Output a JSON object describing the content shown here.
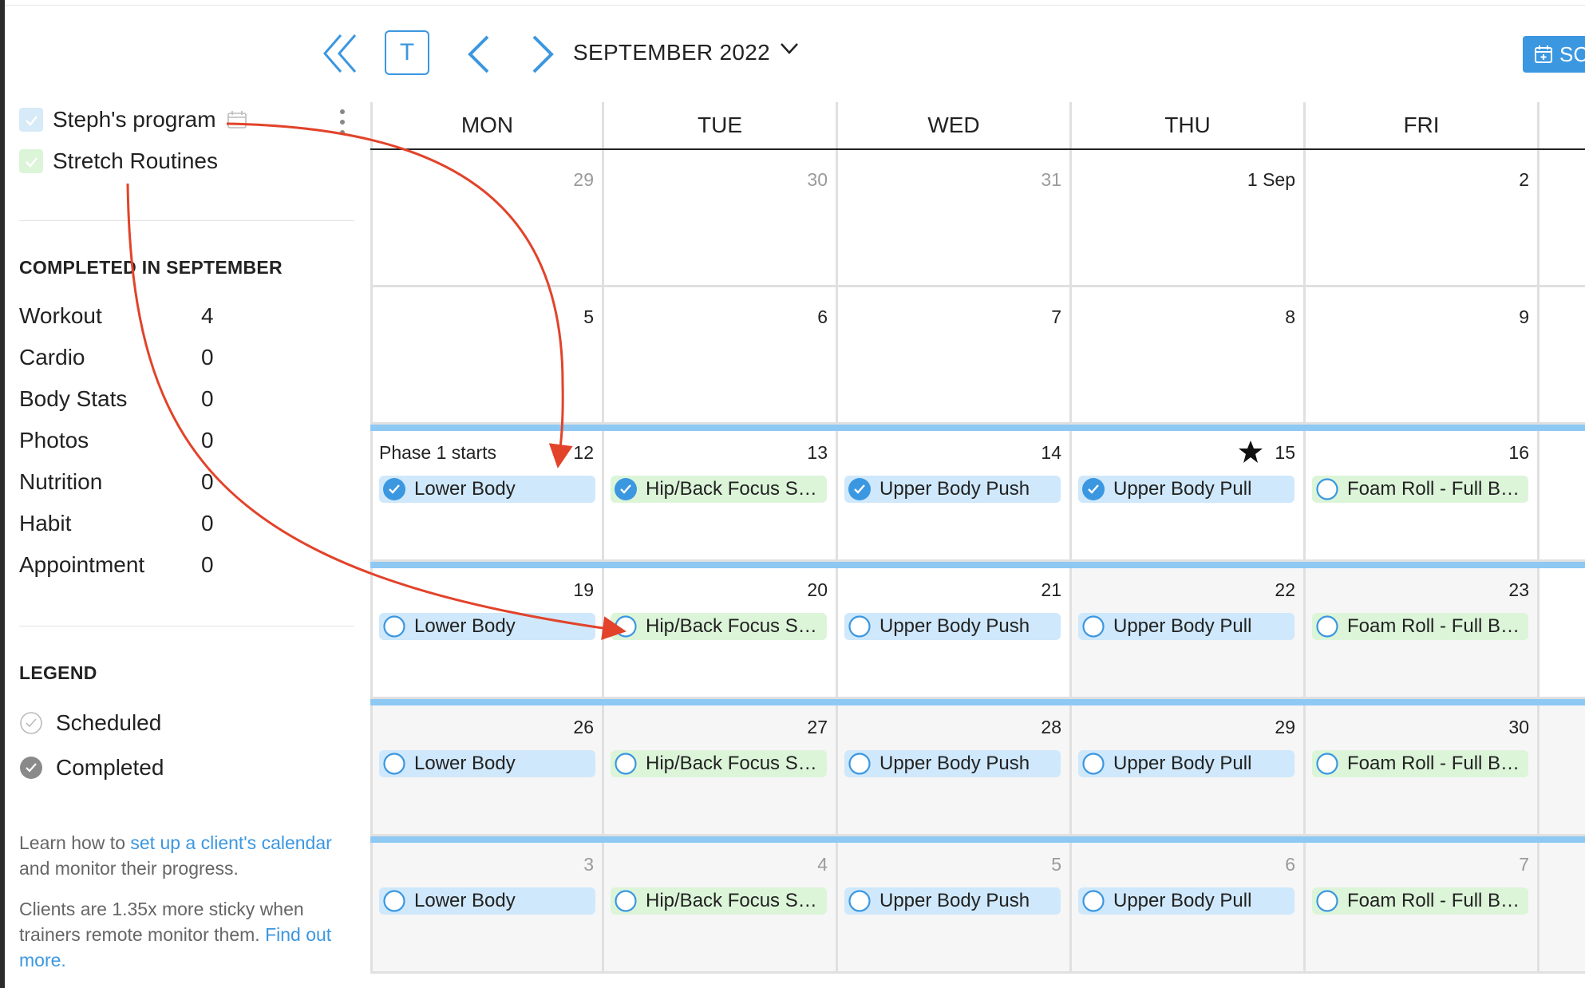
{
  "colors": {
    "accent": "#3b97e0",
    "event_blue": "#cfe8fb",
    "event_green": "#dcf5d9",
    "arrow": "#e2432a",
    "week_bar": "#8ec9f4"
  },
  "sidebar": {
    "programs": [
      {
        "label": "Steph's program",
        "checked": true,
        "color": "#d6eaf8"
      },
      {
        "label": "Stretch Routines",
        "checked": true,
        "color": "#dcf5d9"
      }
    ],
    "completed_title": "COMPLETED IN SEPTEMBER",
    "stats": [
      {
        "name": "Workout",
        "value": "4"
      },
      {
        "name": "Cardio",
        "value": "0"
      },
      {
        "name": "Body Stats",
        "value": "0"
      },
      {
        "name": "Photos",
        "value": "0"
      },
      {
        "name": "Nutrition",
        "value": "0"
      },
      {
        "name": "Habit",
        "value": "0"
      },
      {
        "name": "Appointment",
        "value": "0"
      }
    ],
    "legend_title": "LEGEND",
    "legend": [
      {
        "label": "Scheduled",
        "icon": "scheduled-circle-icon"
      },
      {
        "label": "Completed",
        "icon": "completed-check-icon"
      }
    ],
    "info1": {
      "pre": "Learn how to ",
      "link": "set up a client's calendar",
      "post": " and monitor their progress."
    },
    "info2": {
      "pre": "Clients are 1.35x more sticky when trainers remote monitor them. ",
      "link": "Find out more."
    }
  },
  "toolbar": {
    "today_label": "T",
    "month": "SEPTEMBER 2022",
    "schedule_label": "SC"
  },
  "calendar": {
    "days": [
      "MON",
      "TUE",
      "WED",
      "THU",
      "FRI"
    ],
    "weeks": [
      {
        "bar": false,
        "cells": [
          {
            "d": "29",
            "muted": true,
            "events": []
          },
          {
            "d": "30",
            "muted": true,
            "events": []
          },
          {
            "d": "31",
            "muted": true,
            "events": []
          },
          {
            "d": "1 Sep",
            "events": []
          },
          {
            "d": "2",
            "events": []
          }
        ]
      },
      {
        "bar": false,
        "cells": [
          {
            "d": "5",
            "events": []
          },
          {
            "d": "6",
            "events": []
          },
          {
            "d": "7",
            "events": []
          },
          {
            "d": "8",
            "events": []
          },
          {
            "d": "9",
            "events": []
          }
        ]
      },
      {
        "bar": true,
        "cells": [
          {
            "d": "12",
            "note": "Phase 1 starts",
            "events": [
              {
                "label": "Lower Body",
                "color": "blue",
                "done": true
              }
            ]
          },
          {
            "d": "13",
            "events": [
              {
                "label": "Hip/Back Focus Stretch",
                "color": "green",
                "done": true
              }
            ]
          },
          {
            "d": "14",
            "events": [
              {
                "label": "Upper Body Push",
                "color": "blue",
                "done": true
              }
            ]
          },
          {
            "d": "15",
            "star": true,
            "events": [
              {
                "label": "Upper Body Pull",
                "color": "blue",
                "done": true
              }
            ]
          },
          {
            "d": "16",
            "events": [
              {
                "label": "Foam Roll - Full Body",
                "color": "green",
                "done": false
              }
            ]
          }
        ]
      },
      {
        "bar": true,
        "cells": [
          {
            "d": "19",
            "events": [
              {
                "label": "Lower Body",
                "color": "blue",
                "done": false
              }
            ]
          },
          {
            "d": "20",
            "events": [
              {
                "label": "Hip/Back Focus Stretch",
                "color": "green",
                "done": false
              }
            ]
          },
          {
            "d": "21",
            "events": [
              {
                "label": "Upper Body Push",
                "color": "blue",
                "done": false
              }
            ]
          },
          {
            "d": "22",
            "shaded": true,
            "events": [
              {
                "label": "Upper Body Pull",
                "color": "blue",
                "done": false
              }
            ]
          },
          {
            "d": "23",
            "shaded": true,
            "events": [
              {
                "label": "Foam Roll - Full Body",
                "color": "green",
                "done": false
              }
            ]
          }
        ]
      },
      {
        "bar": true,
        "shaded": true,
        "cells": [
          {
            "d": "26",
            "shaded": true,
            "events": [
              {
                "label": "Lower Body",
                "color": "blue",
                "done": false
              }
            ]
          },
          {
            "d": "27",
            "shaded": true,
            "events": [
              {
                "label": "Hip/Back Focus Stretch",
                "color": "green",
                "done": false
              }
            ]
          },
          {
            "d": "28",
            "shaded": true,
            "events": [
              {
                "label": "Upper Body Push",
                "color": "blue",
                "done": false
              }
            ]
          },
          {
            "d": "29",
            "shaded": true,
            "events": [
              {
                "label": "Upper Body Pull",
                "color": "blue",
                "done": false
              }
            ]
          },
          {
            "d": "30",
            "shaded": true,
            "events": [
              {
                "label": "Foam Roll - Full Body",
                "color": "green",
                "done": false
              }
            ]
          }
        ]
      },
      {
        "bar": true,
        "shaded": true,
        "cells": [
          {
            "d": "3",
            "muted": true,
            "shaded": true,
            "events": [
              {
                "label": "Lower Body",
                "color": "blue",
                "done": false
              }
            ]
          },
          {
            "d": "4",
            "muted": true,
            "shaded": true,
            "events": [
              {
                "label": "Hip/Back Focus Stretch",
                "color": "green",
                "done": false
              }
            ]
          },
          {
            "d": "5",
            "muted": true,
            "shaded": true,
            "events": [
              {
                "label": "Upper Body Push",
                "color": "blue",
                "done": false
              }
            ]
          },
          {
            "d": "6",
            "muted": true,
            "shaded": true,
            "events": [
              {
                "label": "Upper Body Pull",
                "color": "blue",
                "done": false
              }
            ]
          },
          {
            "d": "7",
            "muted": true,
            "shaded": true,
            "events": [
              {
                "label": "Foam Roll - Full Body",
                "color": "green",
                "done": false
              }
            ]
          }
        ]
      }
    ]
  }
}
